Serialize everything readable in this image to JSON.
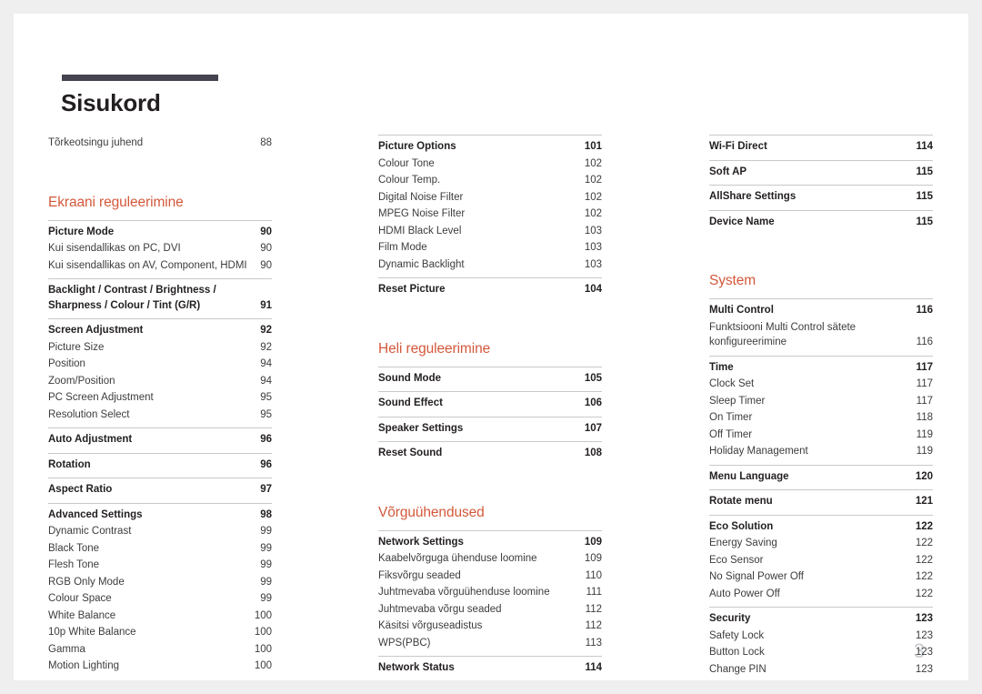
{
  "document": {
    "title": "Sisukord",
    "folio": "3",
    "accent_color": "#d4583a",
    "rule_color": "#45434f",
    "text_color": "#231f20"
  },
  "columns": [
    {
      "id": "column-1",
      "blocks": [
        {
          "type": "group",
          "rule": false,
          "rows": [
            {
              "style": "plain",
              "label": "Tõrkeotsingu juhend",
              "page": "88"
            }
          ]
        },
        {
          "type": "section",
          "spacing": "large",
          "heading": "Ekraani reguleerimine"
        },
        {
          "type": "group",
          "rule": true,
          "rows": [
            {
              "style": "head",
              "label": "Picture Mode",
              "page": "90"
            },
            {
              "style": "sub",
              "label": "Kui sisendallikas on PC, DVI",
              "page": "90"
            },
            {
              "style": "sub",
              "label": "Kui sisendallikas on AV, Component, HDMI",
              "page": "90"
            }
          ]
        },
        {
          "type": "group",
          "rule": true,
          "rows": [
            {
              "style": "head",
              "wrapped": true,
              "label": "Backlight / Contrast / Brightness / Sharpness / Colour / Tint (G/R)",
              "page": "91"
            }
          ]
        },
        {
          "type": "group",
          "rule": true,
          "rows": [
            {
              "style": "head",
              "label": "Screen Adjustment",
              "page": "92"
            },
            {
              "style": "sub",
              "label": "Picture Size",
              "page": "92"
            },
            {
              "style": "sub",
              "label": "Position",
              "page": "94"
            },
            {
              "style": "sub",
              "label": "Zoom/Position",
              "page": "94"
            },
            {
              "style": "sub",
              "label": "PC Screen Adjustment",
              "page": "95"
            },
            {
              "style": "sub",
              "label": "Resolution Select",
              "page": "95"
            }
          ]
        },
        {
          "type": "group",
          "rule": true,
          "rows": [
            {
              "style": "head",
              "label": "Auto Adjustment",
              "page": "96"
            }
          ]
        },
        {
          "type": "group",
          "rule": true,
          "rows": [
            {
              "style": "head",
              "label": "Rotation",
              "page": "96"
            }
          ]
        },
        {
          "type": "group",
          "rule": true,
          "rows": [
            {
              "style": "head",
              "label": "Aspect Ratio",
              "page": "97"
            }
          ]
        },
        {
          "type": "group",
          "rule": true,
          "rows": [
            {
              "style": "head",
              "label": "Advanced Settings",
              "page": "98"
            },
            {
              "style": "sub",
              "label": "Dynamic Contrast",
              "page": "99"
            },
            {
              "style": "sub",
              "label": "Black Tone",
              "page": "99"
            },
            {
              "style": "sub",
              "label": "Flesh Tone",
              "page": "99"
            },
            {
              "style": "sub",
              "label": "RGB Only Mode",
              "page": "99"
            },
            {
              "style": "sub",
              "label": "Colour Space",
              "page": "99"
            },
            {
              "style": "sub",
              "label": "White Balance",
              "page": "100"
            },
            {
              "style": "sub",
              "label": "10p White Balance",
              "page": "100"
            },
            {
              "style": "sub",
              "label": "Gamma",
              "page": "100"
            },
            {
              "style": "sub",
              "label": "Motion Lighting",
              "page": "100"
            }
          ]
        }
      ]
    },
    {
      "id": "column-2",
      "blocks": [
        {
          "type": "group",
          "rule": true,
          "rows": [
            {
              "style": "head",
              "label": "Picture Options",
              "page": "101"
            },
            {
              "style": "sub",
              "label": "Colour Tone",
              "page": "102"
            },
            {
              "style": "sub",
              "label": "Colour Temp.",
              "page": "102"
            },
            {
              "style": "sub",
              "label": "Digital Noise Filter",
              "page": "102"
            },
            {
              "style": "sub",
              "label": "MPEG Noise Filter",
              "page": "102"
            },
            {
              "style": "sub",
              "label": "HDMI Black Level",
              "page": "103"
            },
            {
              "style": "sub",
              "label": "Film Mode",
              "page": "103"
            },
            {
              "style": "sub",
              "label": "Dynamic Backlight",
              "page": "103"
            }
          ]
        },
        {
          "type": "group",
          "rule": true,
          "rows": [
            {
              "style": "head",
              "label": "Reset Picture",
              "page": "104"
            }
          ]
        },
        {
          "type": "section",
          "spacing": "large",
          "heading": "Heli reguleerimine"
        },
        {
          "type": "group",
          "rule": true,
          "rows": [
            {
              "style": "head",
              "label": "Sound Mode",
              "page": "105"
            }
          ]
        },
        {
          "type": "group",
          "rule": true,
          "rows": [
            {
              "style": "head",
              "label": "Sound Effect",
              "page": "106"
            }
          ]
        },
        {
          "type": "group",
          "rule": true,
          "rows": [
            {
              "style": "head",
              "label": "Speaker Settings",
              "page": "107"
            }
          ]
        },
        {
          "type": "group",
          "rule": true,
          "rows": [
            {
              "style": "head",
              "label": "Reset Sound",
              "page": "108"
            }
          ]
        },
        {
          "type": "section",
          "spacing": "large",
          "heading": "Võrguühendused"
        },
        {
          "type": "group",
          "rule": true,
          "rows": [
            {
              "style": "head",
              "label": "Network Settings",
              "page": "109"
            },
            {
              "style": "sub",
              "label": "Kaabelvõrguga ühenduse loomine",
              "page": "109"
            },
            {
              "style": "sub",
              "label": "Fiksvõrgu seaded",
              "page": "110"
            },
            {
              "style": "sub",
              "label": "Juhtmevaba võrguühenduse loomine",
              "page": "111"
            },
            {
              "style": "sub",
              "label": "Juhtmevaba võrgu seaded",
              "page": "112"
            },
            {
              "style": "sub",
              "label": "Käsitsi võrguseadistus",
              "page": "112"
            },
            {
              "style": "sub",
              "label": "WPS(PBC)",
              "page": "113"
            }
          ]
        },
        {
          "type": "group",
          "rule": true,
          "rows": [
            {
              "style": "head",
              "label": "Network Status",
              "page": "114"
            }
          ]
        }
      ]
    },
    {
      "id": "column-3",
      "blocks": [
        {
          "type": "group",
          "rule": true,
          "rows": [
            {
              "style": "head",
              "label": "Wi-Fi Direct",
              "page": "114"
            }
          ]
        },
        {
          "type": "group",
          "rule": true,
          "rows": [
            {
              "style": "head",
              "label": "Soft AP",
              "page": "115"
            }
          ]
        },
        {
          "type": "group",
          "rule": true,
          "rows": [
            {
              "style": "head",
              "label": "AllShare Settings",
              "page": "115"
            }
          ]
        },
        {
          "type": "group",
          "rule": true,
          "rows": [
            {
              "style": "head",
              "label": "Device Name",
              "page": "115"
            }
          ]
        },
        {
          "type": "section",
          "spacing": "large",
          "heading": "System"
        },
        {
          "type": "group",
          "rule": true,
          "rows": [
            {
              "style": "head",
              "label": "Multi Control",
              "page": "116"
            },
            {
              "style": "sub",
              "wrapped": true,
              "label": "Funktsiooni Multi Control sätete konfigureerimine",
              "page": "116"
            }
          ]
        },
        {
          "type": "group",
          "rule": true,
          "rows": [
            {
              "style": "head",
              "label": "Time",
              "page": "117"
            },
            {
              "style": "sub",
              "label": "Clock Set",
              "page": "117"
            },
            {
              "style": "sub",
              "label": "Sleep Timer",
              "page": "117"
            },
            {
              "style": "sub",
              "label": "On Timer",
              "page": "118"
            },
            {
              "style": "sub",
              "label": "Off Timer",
              "page": "119"
            },
            {
              "style": "sub",
              "label": "Holiday Management",
              "page": "119"
            }
          ]
        },
        {
          "type": "group",
          "rule": true,
          "rows": [
            {
              "style": "head",
              "label": "Menu Language",
              "page": "120"
            }
          ]
        },
        {
          "type": "group",
          "rule": true,
          "rows": [
            {
              "style": "head",
              "label": "Rotate menu",
              "page": "121"
            }
          ]
        },
        {
          "type": "group",
          "rule": true,
          "rows": [
            {
              "style": "head",
              "label": "Eco Solution",
              "page": "122"
            },
            {
              "style": "sub",
              "label": "Energy Saving",
              "page": "122"
            },
            {
              "style": "sub",
              "label": "Eco Sensor",
              "page": "122"
            },
            {
              "style": "sub",
              "label": "No Signal Power Off",
              "page": "122"
            },
            {
              "style": "sub",
              "label": "Auto Power Off",
              "page": "122"
            }
          ]
        },
        {
          "type": "group",
          "rule": true,
          "rows": [
            {
              "style": "head",
              "label": "Security",
              "page": "123"
            },
            {
              "style": "sub",
              "label": "Safety Lock",
              "page": "123"
            },
            {
              "style": "sub",
              "label": "Button Lock",
              "page": "123"
            },
            {
              "style": "sub",
              "label": "Change PIN",
              "page": "123"
            }
          ]
        }
      ]
    }
  ]
}
